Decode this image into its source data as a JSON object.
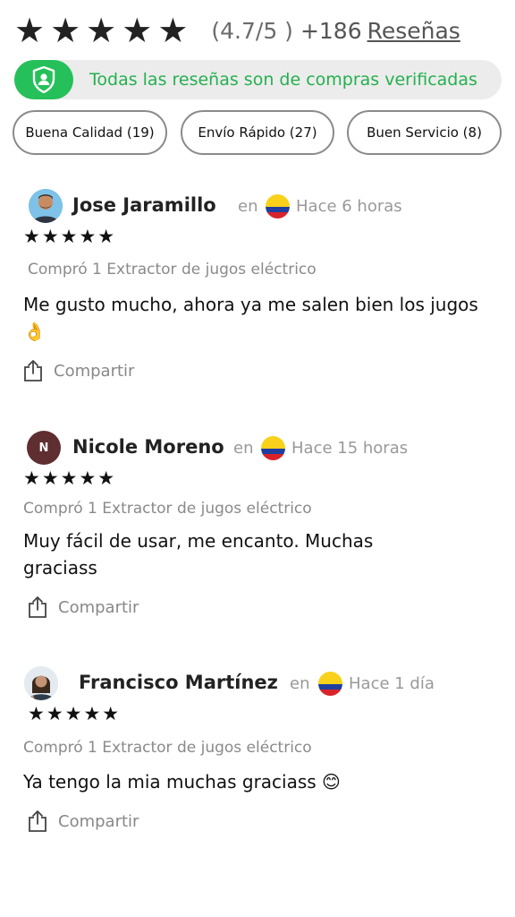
{
  "summary": {
    "stars": [
      "★",
      "★",
      "★",
      "★",
      "★"
    ],
    "rating_text": "(4.7/5 )",
    "count_text": "+186",
    "reviews_link": "Reseñas"
  },
  "verified": {
    "icon": "shield-user-icon",
    "text": "Todas las reseñas son de compras verificadas",
    "colors": {
      "accent": "#25c05a",
      "text": "#25b04f",
      "background": "#ececec"
    }
  },
  "chips": [
    {
      "label": "Buena Calidad (19)"
    },
    {
      "label": "Envío Rápido (27)"
    },
    {
      "label": "Buen Servicio (8)"
    }
  ],
  "reviews": [
    {
      "name": "Jose Jaramillo",
      "avatar_initial": "",
      "en": "en",
      "flag": "colombia-flag-icon",
      "time": "Hace 6 horas",
      "stars": "★★★★★",
      "product": "Compró 1 Extractor de jugos eléctrico",
      "text": "Me gusto mucho, ahora ya me salen bien los jugos 👌",
      "share": "Compartir"
    },
    {
      "name": "Nicole Moreno",
      "avatar_initial": "N",
      "en": "en",
      "flag": "colombia-flag-icon",
      "time": "Hace 15 horas",
      "stars": "★★★★★",
      "product": "Compró 1 Extractor de jugos eléctrico",
      "text": "Muy fácil de usar, me encanto. Muchas graciass",
      "share": "Compartir"
    },
    {
      "name": "Francisco Martínez",
      "avatar_initial": "",
      "en": "en",
      "flag": "colombia-flag-icon",
      "time": "Hace 1 día",
      "stars": "★★★★★",
      "product": "Compró 1 Extractor de jugos eléctrico",
      "text": "Ya tengo la mia muchas graciass 😊",
      "share": "Compartir"
    }
  ]
}
